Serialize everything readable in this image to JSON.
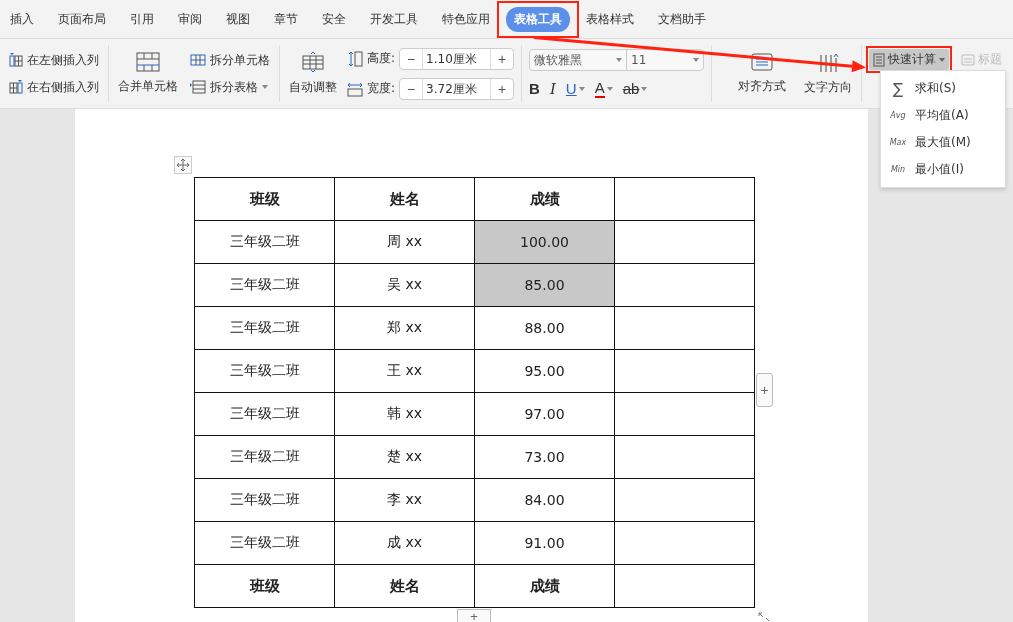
{
  "menu_tabs": [
    {
      "label": "插入",
      "selected": false,
      "highlighted": false
    },
    {
      "label": "页面布局",
      "selected": false,
      "highlighted": false
    },
    {
      "label": "引用",
      "selected": false,
      "highlighted": false
    },
    {
      "label": "审阅",
      "selected": false,
      "highlighted": false
    },
    {
      "label": "视图",
      "selected": false,
      "highlighted": false
    },
    {
      "label": "章节",
      "selected": false,
      "highlighted": false
    },
    {
      "label": "安全",
      "selected": false,
      "highlighted": false
    },
    {
      "label": "开发工具",
      "selected": false,
      "highlighted": false
    },
    {
      "label": "特色应用",
      "selected": false,
      "highlighted": false
    },
    {
      "label": "表格工具",
      "selected": true,
      "highlighted": true
    },
    {
      "label": "表格样式",
      "selected": false,
      "highlighted": false
    },
    {
      "label": "文档助手",
      "selected": false,
      "highlighted": false
    }
  ],
  "ribbon": {
    "insert_left": "在左侧插入列",
    "insert_right": "在右侧插入列",
    "merge_cells": "合并单元格",
    "split_cells": "拆分单元格",
    "split_table": "拆分表格",
    "auto_fit": "自动调整",
    "height": {
      "label": "高度:",
      "value": "1.10厘米",
      "minus": "−",
      "plus": "+"
    },
    "width": {
      "label": "宽度:",
      "value": "3.72厘米",
      "minus": "−",
      "plus": "+"
    },
    "font": "微软雅黑",
    "font_size": "11",
    "format_buttons": [
      {
        "label": "B",
        "kind": "bold",
        "dropdown": false
      },
      {
        "label": "I",
        "kind": "italic",
        "dropdown": false
      },
      {
        "label": "U",
        "kind": "underline",
        "dropdown": true
      },
      {
        "label": "A",
        "kind": "color",
        "dropdown": true
      },
      {
        "label": "ab",
        "kind": "highlight",
        "dropdown": true
      }
    ],
    "align": "对齐方式",
    "text_direction": "文字方向",
    "quick_calc": {
      "label": "快速计算",
      "highlighted": true,
      "expanded": true
    },
    "title_row": {
      "label": "标题",
      "disabled": true
    }
  },
  "quick_calc_menu": [
    {
      "icon_text": "∑",
      "label": "求和(S)"
    },
    {
      "icon_text": "Avg",
      "label": "平均值(A)"
    },
    {
      "icon_text": "Max",
      "label": "最大值(M)"
    },
    {
      "icon_text": "Min",
      "label": "最小值(I)"
    }
  ],
  "table": {
    "rows": [
      {
        "header": true,
        "cells": [
          {
            "text": "班级",
            "shaded": false
          },
          {
            "text": "姓名",
            "shaded": false
          },
          {
            "text": "成绩",
            "shaded": false
          },
          {
            "text": "",
            "shaded": false
          }
        ]
      },
      {
        "header": false,
        "cells": [
          {
            "text": "三年级二班",
            "shaded": false
          },
          {
            "text": "周 xx",
            "shaded": false
          },
          {
            "text": "100.00",
            "shaded": true
          },
          {
            "text": "",
            "shaded": false
          }
        ]
      },
      {
        "header": false,
        "cells": [
          {
            "text": "三年级二班",
            "shaded": false
          },
          {
            "text": "吴 xx",
            "shaded": false
          },
          {
            "text": "85.00",
            "shaded": true
          },
          {
            "text": "",
            "shaded": false
          }
        ]
      },
      {
        "header": false,
        "cells": [
          {
            "text": "三年级二班",
            "shaded": false
          },
          {
            "text": "郑 xx",
            "shaded": false
          },
          {
            "text": "88.00",
            "shaded": false
          },
          {
            "text": "",
            "shaded": false
          }
        ]
      },
      {
        "header": false,
        "cells": [
          {
            "text": "三年级二班",
            "shaded": false
          },
          {
            "text": "王 xx",
            "shaded": false
          },
          {
            "text": "95.00",
            "shaded": false
          },
          {
            "text": "",
            "shaded": false
          }
        ]
      },
      {
        "header": false,
        "cells": [
          {
            "text": "三年级二班",
            "shaded": false
          },
          {
            "text": "韩 xx",
            "shaded": false
          },
          {
            "text": "97.00",
            "shaded": false
          },
          {
            "text": "",
            "shaded": false
          }
        ]
      },
      {
        "header": false,
        "cells": [
          {
            "text": "三年级二班",
            "shaded": false
          },
          {
            "text": "楚 xx",
            "shaded": false
          },
          {
            "text": "73.00",
            "shaded": false
          },
          {
            "text": "",
            "shaded": false
          }
        ]
      },
      {
        "header": false,
        "cells": [
          {
            "text": "三年级二班",
            "shaded": false
          },
          {
            "text": "李 xx",
            "shaded": false
          },
          {
            "text": "84.00",
            "shaded": false
          },
          {
            "text": "",
            "shaded": false
          }
        ]
      },
      {
        "header": false,
        "cells": [
          {
            "text": "三年级二班",
            "shaded": false
          },
          {
            "text": "成 xx",
            "shaded": false
          },
          {
            "text": "91.00",
            "shaded": false
          },
          {
            "text": "",
            "shaded": false
          }
        ]
      },
      {
        "header": true,
        "cells": [
          {
            "text": "班级",
            "shaded": false
          },
          {
            "text": "姓名",
            "shaded": false
          },
          {
            "text": "成绩",
            "shaded": false
          },
          {
            "text": "",
            "shaded": false
          }
        ]
      }
    ],
    "add_row": "+",
    "add_column": "+"
  }
}
